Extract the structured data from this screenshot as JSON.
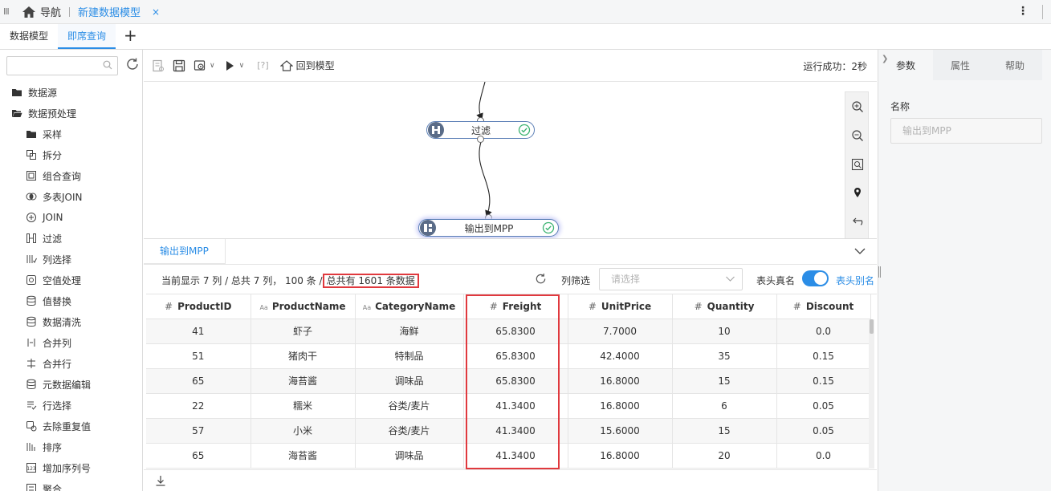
{
  "topbar": {
    "nav_label": "导航",
    "doc_tab": "新建数据模型",
    "close_glyph": "×",
    "more_glyph": "⋮",
    "grip_glyph": "III"
  },
  "tabs": [
    {
      "label": "数据模型"
    },
    {
      "label": "即席查询"
    }
  ],
  "tabs_add": "+",
  "sidebar": {
    "search_placeholder": "",
    "tree": [
      {
        "label": "数据源",
        "icon": "folder-icon",
        "level": 0
      },
      {
        "label": "数据预处理",
        "icon": "folder-open-icon",
        "level": 0
      },
      {
        "label": "采样",
        "icon": "folder-icon",
        "level": 1
      },
      {
        "label": "拆分",
        "icon": "split-icon",
        "level": 1
      },
      {
        "label": "组合查询",
        "icon": "combine-query-icon",
        "level": 1
      },
      {
        "label": "多表JOIN",
        "icon": "multi-join-icon",
        "level": 1
      },
      {
        "label": "JOIN",
        "icon": "join-icon",
        "level": 1
      },
      {
        "label": "过滤",
        "icon": "filter-icon",
        "level": 1
      },
      {
        "label": "列选择",
        "icon": "column-select-icon",
        "level": 1
      },
      {
        "label": "空值处理",
        "icon": "null-handle-icon",
        "level": 1
      },
      {
        "label": "值替换",
        "icon": "value-replace-icon",
        "level": 1
      },
      {
        "label": "数据清洗",
        "icon": "data-clean-icon",
        "level": 1
      },
      {
        "label": "合并列",
        "icon": "merge-column-icon",
        "level": 1
      },
      {
        "label": "合并行",
        "icon": "merge-row-icon",
        "level": 1
      },
      {
        "label": "元数据编辑",
        "icon": "metadata-edit-icon",
        "level": 1
      },
      {
        "label": "行选择",
        "icon": "row-select-icon",
        "level": 1
      },
      {
        "label": "去除重复值",
        "icon": "dedupe-icon",
        "level": 1
      },
      {
        "label": "排序",
        "icon": "sort-icon",
        "level": 1
      },
      {
        "label": "增加序列号",
        "icon": "add-serial-icon",
        "level": 1
      },
      {
        "label": "聚合",
        "icon": "aggregate-icon",
        "level": 1
      }
    ]
  },
  "toolbar": {
    "back_label": "回到模型",
    "status": "运行成功：2秒",
    "bracket_glyph": "[?]"
  },
  "flow": {
    "nodes": [
      {
        "label": "过滤",
        "icon": "filter-icon",
        "status": "success"
      },
      {
        "label": "输出到MPP",
        "icon": "output-icon",
        "status": "success"
      }
    ]
  },
  "right_panel": {
    "tabs": [
      {
        "label": "参数"
      },
      {
        "label": "属性"
      },
      {
        "label": "帮助"
      }
    ],
    "name_label": "名称",
    "name_placeholder": "输出到MPP"
  },
  "result": {
    "tab_label": "输出到MPP",
    "info_prefix": "当前显示 7 列 / 总共 7 列， 100 条 /",
    "info_highlight": "总共有 1601 条数据",
    "column_filter_label": "列筛选",
    "select_placeholder": "请选择",
    "header_real_name": "表头真名",
    "header_alias": "表头别名",
    "toggle_on": true,
    "columns": [
      {
        "name": "ProductID",
        "type": "#"
      },
      {
        "name": "ProductName",
        "type": "Aa"
      },
      {
        "name": "CategoryName",
        "type": "Aa"
      },
      {
        "name": "Freight",
        "type": "#"
      },
      {
        "name": "UnitPrice",
        "type": "#"
      },
      {
        "name": "Quantity",
        "type": "#"
      },
      {
        "name": "Discount",
        "type": "#"
      }
    ],
    "rows": [
      [
        "41",
        "虾子",
        "海鲜",
        "65.8300",
        "7.7000",
        "10",
        "0.0"
      ],
      [
        "51",
        "猪肉干",
        "特制品",
        "65.8300",
        "42.4000",
        "35",
        "0.15"
      ],
      [
        "65",
        "海苔酱",
        "调味品",
        "65.8300",
        "16.8000",
        "15",
        "0.15"
      ],
      [
        "22",
        "糯米",
        "谷类/麦片",
        "41.3400",
        "16.8000",
        "6",
        "0.05"
      ],
      [
        "57",
        "小米",
        "谷类/麦片",
        "41.3400",
        "15.6000",
        "15",
        "0.05"
      ],
      [
        "65",
        "海苔酱",
        "调味品",
        "41.3400",
        "16.8000",
        "20",
        "0.0"
      ]
    ]
  },
  "colors": {
    "accent": "#2b8de6",
    "highlight": "#e0393e",
    "node_border": "#5b7fb6",
    "success": "#3cb371"
  }
}
